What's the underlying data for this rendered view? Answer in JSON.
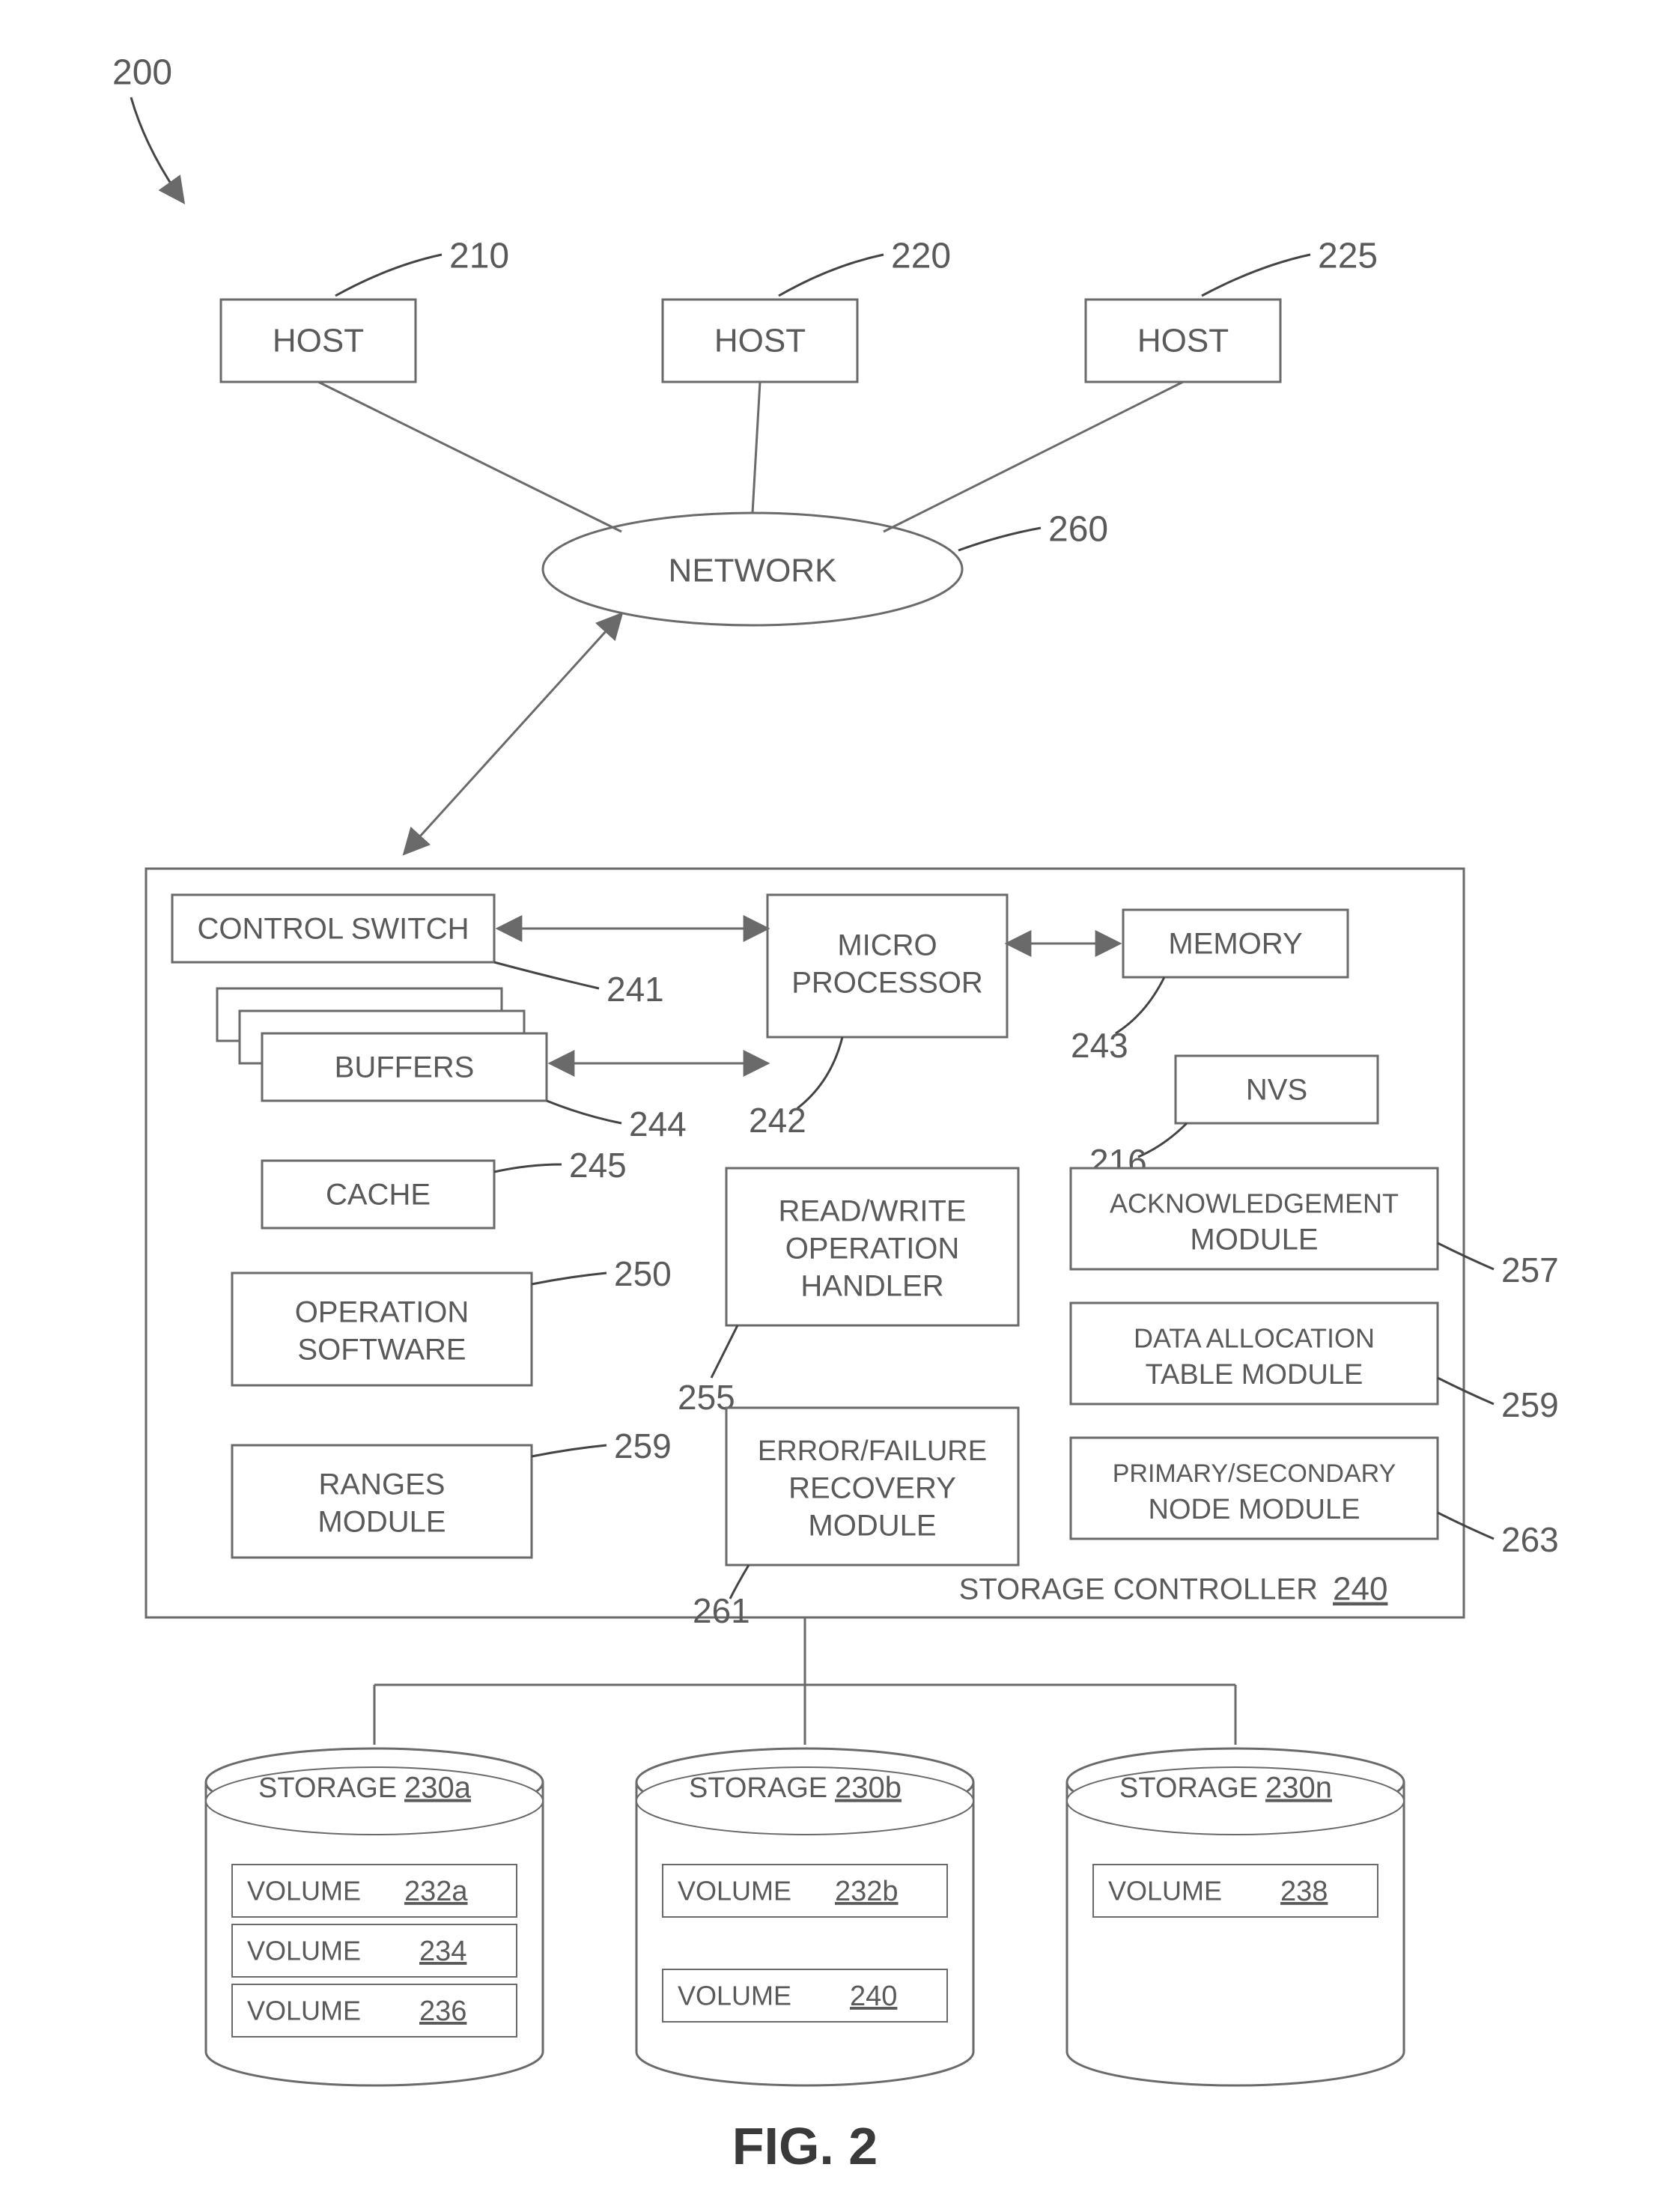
{
  "figure": {
    "ref": "200",
    "caption": "FIG. 2"
  },
  "hosts": [
    {
      "label": "HOST",
      "ref": "210"
    },
    {
      "label": "HOST",
      "ref": "220"
    },
    {
      "label": "HOST",
      "ref": "225"
    }
  ],
  "network": {
    "label": "NETWORK",
    "ref": "260"
  },
  "controller": {
    "title": "STORAGE CONTROLLER",
    "ref": "240",
    "control_switch": {
      "label": "CONTROL SWITCH",
      "ref": "241"
    },
    "buffers": {
      "label": "BUFFERS",
      "ref": "244"
    },
    "cache": {
      "label": "CACHE",
      "ref": "245"
    },
    "op_software": {
      "l1": "OPERATION",
      "l2": "SOFTWARE",
      "ref": "250"
    },
    "ranges": {
      "l1": "RANGES",
      "l2": "MODULE",
      "ref": "259"
    },
    "micro": {
      "l1": "MICRO",
      "l2": "PROCESSOR",
      "ref": "242"
    },
    "memory": {
      "label": "MEMORY",
      "ref": "243"
    },
    "nvs": {
      "label": "NVS",
      "ref": "216"
    },
    "rw_handler": {
      "l1": "READ/WRITE",
      "l2": "OPERATION",
      "l3": "HANDLER",
      "ref": "255"
    },
    "err_recovery": {
      "l1": "ERROR/FAILURE",
      "l2": "RECOVERY",
      "l3": "MODULE",
      "ref": "261"
    },
    "ack_module": {
      "l1": "ACKNOWLEDGEMENT",
      "l2": "MODULE",
      "ref": "257"
    },
    "dat_module": {
      "l1": "DATA ALLOCATION",
      "l2": "TABLE MODULE",
      "ref": "259"
    },
    "ps_node": {
      "l1": "PRIMARY/SECONDARY",
      "l2": "NODE MODULE",
      "ref": "263"
    }
  },
  "storages": [
    {
      "label": "STORAGE",
      "ref": "230a",
      "volumes": [
        {
          "label": "VOLUME",
          "ref": "232a"
        },
        {
          "label": "VOLUME",
          "ref": "234"
        },
        {
          "label": "VOLUME",
          "ref": "236"
        }
      ]
    },
    {
      "label": "STORAGE",
      "ref": "230b",
      "volumes": [
        {
          "label": "VOLUME",
          "ref": "232b"
        },
        {
          "label": "VOLUME",
          "ref": "240"
        }
      ]
    },
    {
      "label": "STORAGE",
      "ref": "230n",
      "volumes": [
        {
          "label": "VOLUME",
          "ref": "238"
        }
      ]
    }
  ]
}
